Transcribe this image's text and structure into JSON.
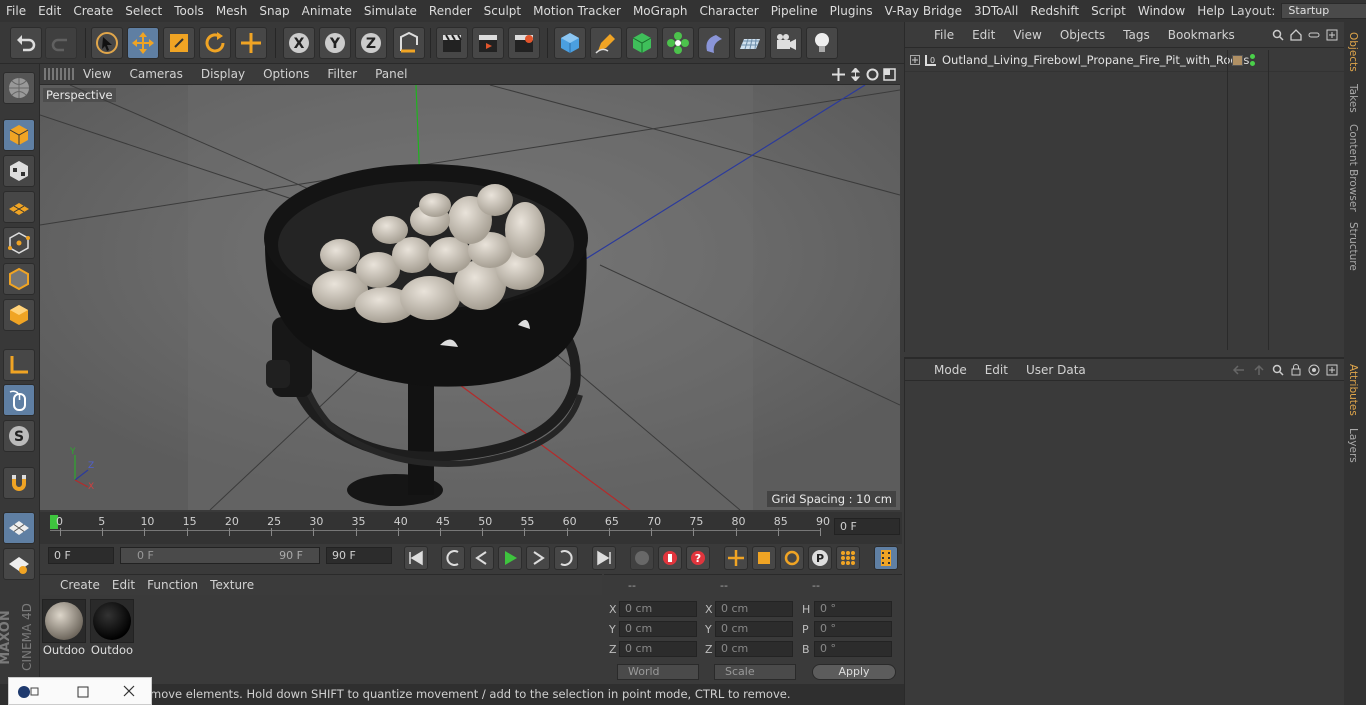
{
  "menubar": {
    "items": [
      "File",
      "Edit",
      "Create",
      "Select",
      "Tools",
      "Mesh",
      "Snap",
      "Animate",
      "Simulate",
      "Render",
      "Sculpt",
      "Motion Tracker",
      "MoGraph",
      "Character",
      "Pipeline",
      "Plugins",
      "V-Ray Bridge",
      "3DToAll",
      "Redshift",
      "Script",
      "Window",
      "Help"
    ],
    "layout_label": "Layout:",
    "layout_value": "Startup"
  },
  "viewport": {
    "menu": [
      "View",
      "Cameras",
      "Display",
      "Options",
      "Filter",
      "Panel"
    ],
    "label": "Perspective",
    "grid_spacing": "Grid Spacing : 10 cm",
    "axes": {
      "x": "X",
      "y": "Y",
      "z": "Z"
    }
  },
  "timeline": {
    "ticks": [
      "0",
      "5",
      "10",
      "15",
      "20",
      "25",
      "30",
      "35",
      "40",
      "45",
      "50",
      "55",
      "60",
      "65",
      "70",
      "75",
      "80",
      "85",
      "90"
    ],
    "current_frame": "0 F",
    "start_frame": "0 F",
    "range_start": "0 F",
    "range_end": "90 F",
    "end_frame": "90 F"
  },
  "materials": {
    "menu": [
      "Create",
      "Edit",
      "Function",
      "Texture"
    ],
    "items": [
      {
        "name": "Outdoo"
      },
      {
        "name": "Outdoo"
      }
    ]
  },
  "coordinates": {
    "headers": [
      "--",
      "--",
      "--"
    ],
    "rows": [
      {
        "l1": "X",
        "v1": "0 cm",
        "l2": "X",
        "v2": "0 cm",
        "l3": "H",
        "v3": "0 °"
      },
      {
        "l1": "Y",
        "v1": "0 cm",
        "l2": "Y",
        "v2": "0 cm",
        "l3": "P",
        "v3": "0 °"
      },
      {
        "l1": "Z",
        "v1": "0 cm",
        "l2": "Z",
        "v2": "0 cm",
        "l3": "B",
        "v3": "0 °"
      }
    ],
    "world": "World",
    "scale": "Scale",
    "apply": "Apply"
  },
  "status": "move elements. Hold down SHIFT to quantize movement / add to the selection in point mode, CTRL to remove.",
  "brand": {
    "maxon": "MAXON",
    "cinema": "CINEMA 4D"
  },
  "objects": {
    "menu": [
      "File",
      "Edit",
      "View",
      "Objects",
      "Tags",
      "Bookmarks"
    ],
    "items": [
      {
        "name": "Outland_Living_Firebowl_Propane_Fire_Pit_with_Rocks"
      }
    ]
  },
  "attributes": {
    "menu": [
      "Mode",
      "Edit",
      "User Data"
    ]
  },
  "right_tabs": [
    "Objects",
    "Takes",
    "Content Browser",
    "Structure",
    "Attributes",
    "Layers"
  ],
  "colors": {
    "accent": "#5f7fa3",
    "active_tab": "#e0a64b",
    "play": "#3ec43e"
  }
}
